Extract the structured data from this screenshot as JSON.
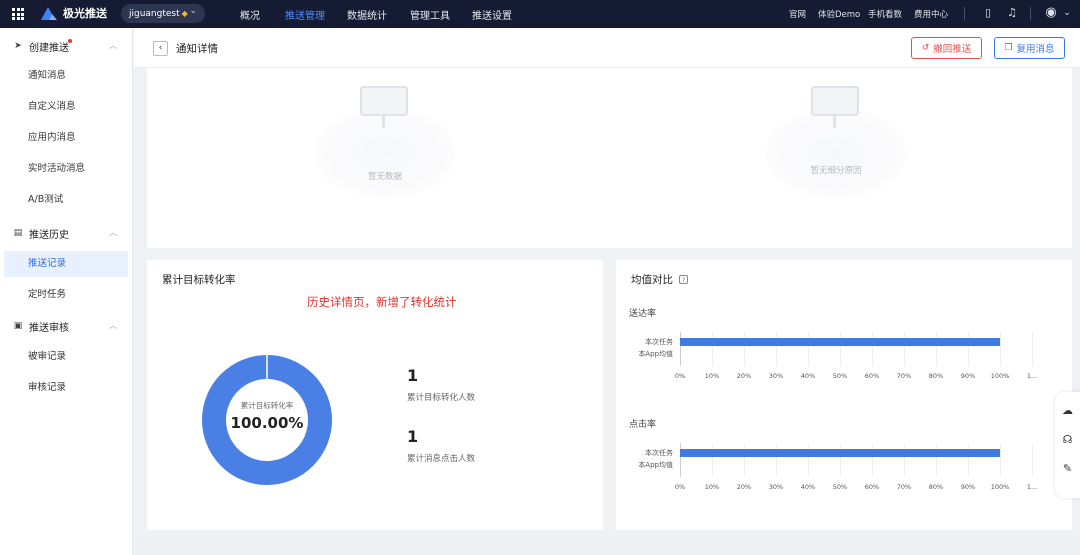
{
  "topbar": {
    "brand": "极光推送",
    "app_name": "jiguangtest",
    "nav": [
      {
        "label": "概况",
        "active": false
      },
      {
        "label": "推送管理",
        "active": true
      },
      {
        "label": "数据统计",
        "active": false
      },
      {
        "label": "管理工具",
        "active": false
      },
      {
        "label": "推送设置",
        "active": false
      }
    ],
    "links": [
      "官网",
      "体验Demo",
      "手机看数",
      "费用中心"
    ]
  },
  "sidebar": {
    "groups": [
      {
        "label": "创建推送",
        "icon": "send-icon",
        "has_dot": true,
        "items": [
          "通知消息",
          "自定义消息",
          "应用内消息",
          "实时活动消息",
          "A/B测试"
        ]
      },
      {
        "label": "推送历史",
        "icon": "history-icon",
        "items": [
          "推送记录",
          "定时任务"
        ]
      },
      {
        "label": "推送审核",
        "icon": "audit-icon",
        "items": [
          "被审记录",
          "审核记录"
        ]
      }
    ],
    "active_item": "推送记录"
  },
  "header": {
    "title": "通知详情",
    "revoke_label": "撤回推送",
    "reuse_label": "复用消息"
  },
  "empty_panel": {
    "left_text": "暂无数据",
    "right_text": "暂无细分原因"
  },
  "conversion": {
    "title": "累计目标转化率",
    "annotation": "历史详情页，新增了转化统计",
    "donut_label": "累计目标转化率",
    "donut_value": "100.00%",
    "donut_fraction": 1.0,
    "donut_color": "#4a80e6",
    "stats": [
      {
        "value": "1",
        "label": "累计目标转化人数"
      },
      {
        "value": "1",
        "label": "累计消息点击人数"
      }
    ]
  },
  "average": {
    "title": "均值对比",
    "help_icon": "?",
    "row_labels": [
      "本次任务",
      "本App均值"
    ],
    "ticks": [
      "0%",
      "10%",
      "20%",
      "30%",
      "40%",
      "50%",
      "60%",
      "70%",
      "80%",
      "90%",
      "100%",
      "1..."
    ],
    "bar_color": "#3f7be0"
  },
  "chart_data": [
    {
      "type": "bar",
      "title": "送达率",
      "categories": [
        "本次任务",
        "本App均值"
      ],
      "values": [
        100,
        0
      ],
      "xlim": [
        0,
        110
      ]
    },
    {
      "type": "bar",
      "title": "点击率",
      "categories": [
        "本次任务",
        "本App均值"
      ],
      "values": [
        100,
        0
      ],
      "xlim": [
        0,
        110
      ]
    }
  ]
}
